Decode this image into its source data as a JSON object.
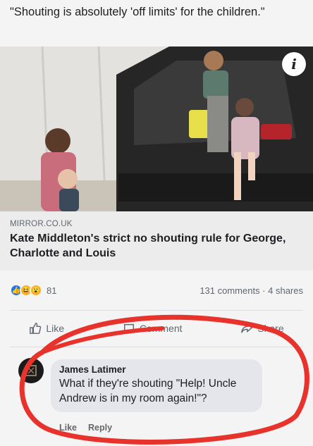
{
  "post": {
    "text": "\"Shouting is absolutely 'off limits' for the children.\""
  },
  "link_card": {
    "source": "MIRROR.CO.UK",
    "headline": "Kate Middleton's strict no shouting rule for George, Charlotte and Louis",
    "info_icon": "info-icon"
  },
  "stats": {
    "reaction_count": "81",
    "comments_shares": "131 comments · 4 shares"
  },
  "actions": {
    "like": "Like",
    "comment": "Comment",
    "share": "Share"
  },
  "comment": {
    "author": "James Latimer",
    "text": "What if they're shouting \"Help! Uncle Andrew is in my room again!\"?",
    "like": "Like",
    "reply": "Reply"
  },
  "colors": {
    "annotation_circle": "#e8322c",
    "like_blue": "#1877f2"
  }
}
